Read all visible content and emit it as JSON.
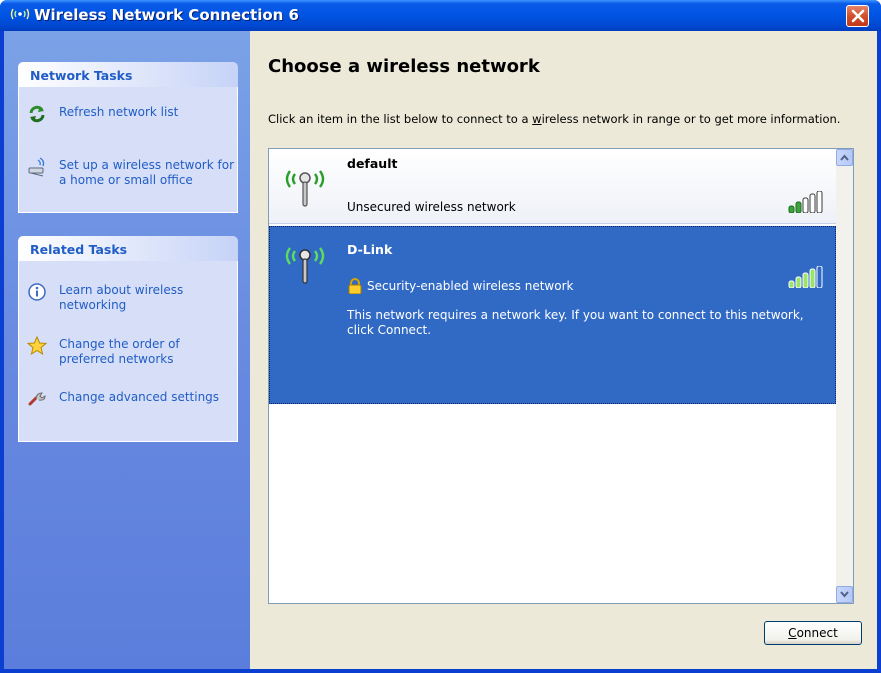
{
  "window": {
    "title": "Wireless Network Connection 6",
    "title_color": "#ffffff",
    "titlebar_color": "#0054e3"
  },
  "sidebar": {
    "network_tasks": {
      "header": "Network Tasks",
      "items": [
        {
          "label": "Refresh network list",
          "icon": "refresh-icon"
        },
        {
          "label": "Set up a wireless network for a home or small office",
          "icon": "wireless-setup-icon"
        }
      ]
    },
    "related_tasks": {
      "header": "Related Tasks",
      "items": [
        {
          "label": "Learn about wireless networking",
          "icon": "info-icon"
        },
        {
          "label": "Change the order of preferred networks",
          "icon": "star-icon"
        },
        {
          "label": "Change advanced settings",
          "icon": "settings-icon"
        }
      ]
    }
  },
  "main": {
    "heading": "Choose a wireless network",
    "instructions_prefix": "Click an item in the list below to connect to a ",
    "instructions_underlined": "w",
    "instructions_suffix": "ireless network in range or to get more information.",
    "networks": [
      {
        "name": "default",
        "status": "Unsecured wireless network",
        "signal_strength": 0.4,
        "selected": false
      },
      {
        "name": "D-Link",
        "status": "Security-enabled wireless network",
        "description": "This network requires a network key. If you want to connect to this network, click Connect.",
        "signal_strength": 0.8,
        "selected": true
      }
    ],
    "connect_button_prefix": "",
    "connect_button_underlined": "C",
    "connect_button_suffix": "onnect"
  },
  "colors": {
    "selection": "#316ac5",
    "link": "#215dc6",
    "close_button": "#d2502a"
  }
}
